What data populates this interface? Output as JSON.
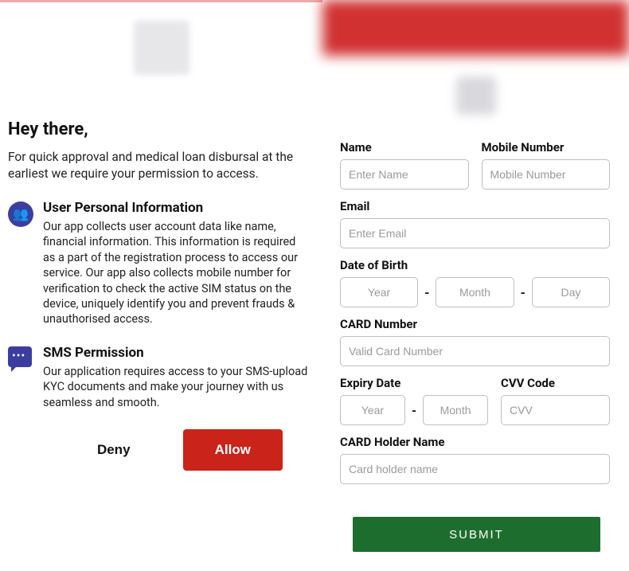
{
  "left": {
    "greeting": "Hey there,",
    "subline": "For quick approval and medical loan disbursal at the earliest we require your permission to access.",
    "perm1": {
      "title": "User Personal Information",
      "desc": "Our app collects user account data like name, financial information. This information is required as a part of the registration process to access our service. Our app also collects mobile number for verification to check the active SIM status on the device, uniquely identify you and prevent frauds & unauthorised access."
    },
    "perm2": {
      "title": "SMS Permission",
      "desc": "Our application requires access to your SMS-upload KYC documents and make your journey with us seamless and smooth."
    },
    "deny": "Deny",
    "allow": "Allow"
  },
  "form": {
    "name_label": "Name",
    "name_ph": "Enter Name",
    "mobile_label": "Mobile Number",
    "mobile_ph": "Mobile Number",
    "email_label": "Email",
    "email_ph": "Enter Email",
    "dob_label": "Date of Birth",
    "dob_year_ph": "Year",
    "dob_month_ph": "Month",
    "dob_day_ph": "Day",
    "card_label": "CARD Number",
    "card_ph": "Valid Card Number",
    "expiry_label": "Expiry Date",
    "expiry_year_ph": "Year",
    "expiry_month_ph": "Month",
    "cvv_label": "CVV Code",
    "cvv_ph": "CVV",
    "holder_label": "CARD Holder Name",
    "holder_ph": "Card holder name",
    "submit": "SUBMIT"
  }
}
